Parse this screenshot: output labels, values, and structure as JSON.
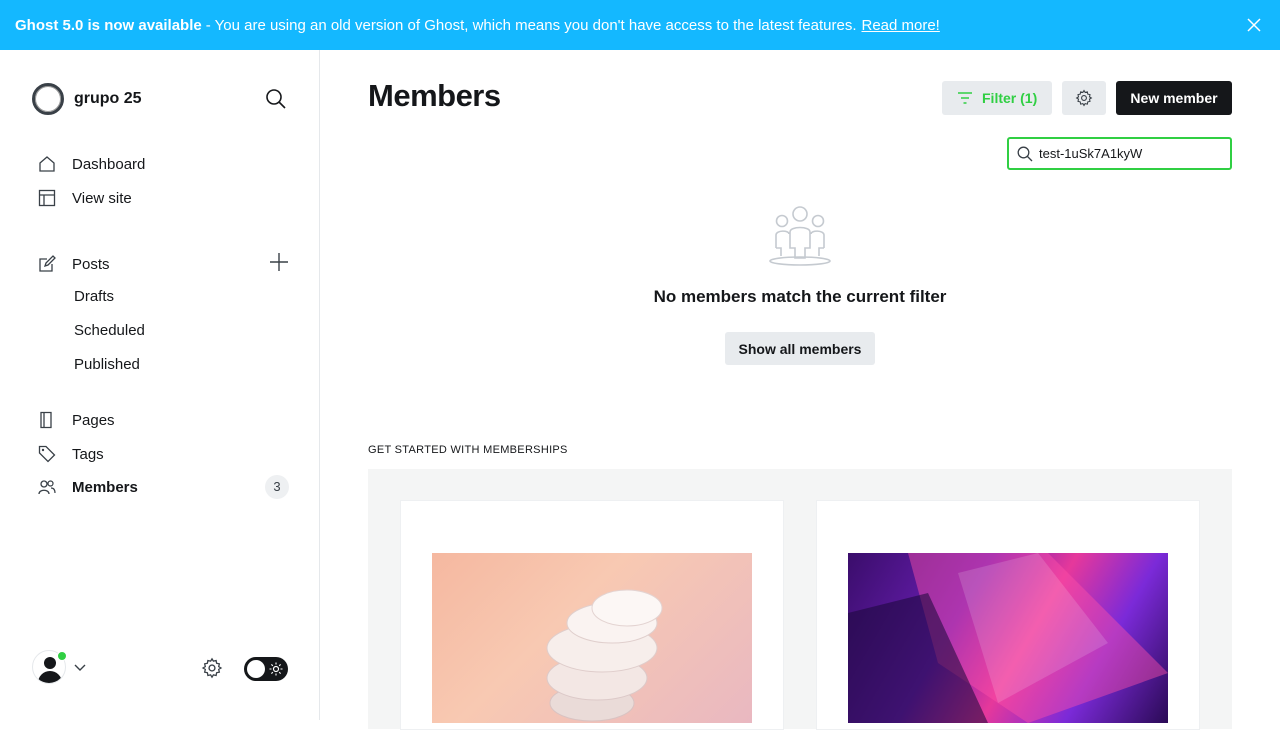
{
  "banner": {
    "headline": "Ghost 5.0 is now available",
    "message": "- You are using an old version of Ghost, which means you don't have access to the latest features.",
    "link": "Read more!"
  },
  "sidebar": {
    "site_name": "grupo 25",
    "items": [
      {
        "label": "Dashboard",
        "icon": "home-icon"
      },
      {
        "label": "View site",
        "icon": "layout-icon"
      },
      {
        "label": "Posts",
        "icon": "edit-icon"
      },
      {
        "label": "Pages",
        "icon": "page-icon"
      },
      {
        "label": "Tags",
        "icon": "tag-icon"
      },
      {
        "label": "Members",
        "icon": "members-icon",
        "count": "3"
      }
    ],
    "post_sub_items": [
      "Drafts",
      "Scheduled",
      "Published"
    ]
  },
  "main": {
    "title": "Members",
    "filter_label": "Filter (1)",
    "new_member_label": "New member",
    "search_value": "test-1uSk7A1kyW",
    "empty_message": "No members match the current filter",
    "show_all_label": "Show all members",
    "section_label": "GET STARTED WITH MEMBERSHIPS"
  },
  "colors": {
    "banner": "#14b8ff",
    "accent_green": "#30cf43",
    "dark": "#15171a"
  }
}
